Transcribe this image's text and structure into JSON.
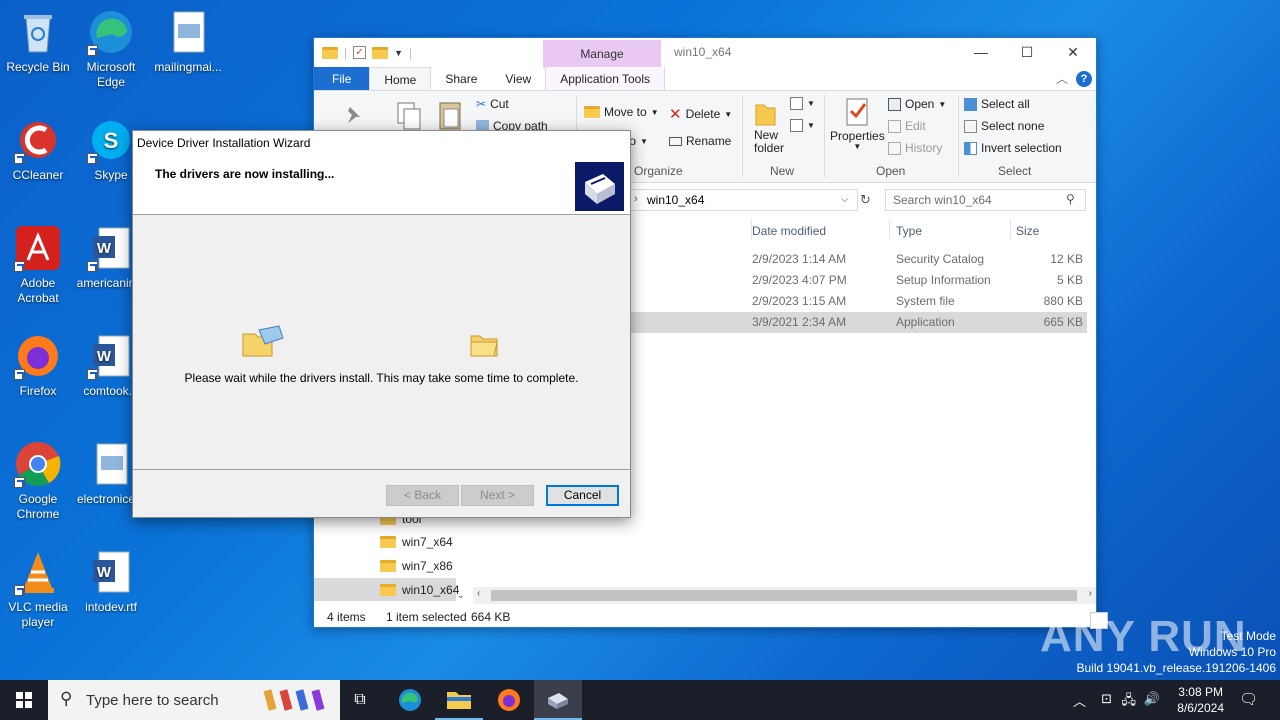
{
  "desktop": {
    "icons": [
      {
        "label": "Recycle Bin",
        "icon": "recycle-bin-icon"
      },
      {
        "label": "Microsoft Edge",
        "icon": "edge-icon"
      },
      {
        "label": "mailingmai...",
        "icon": "image-file-icon"
      },
      {
        "label": "CCleaner",
        "icon": "ccleaner-icon"
      },
      {
        "label": "Skype",
        "icon": "skype-icon"
      },
      {
        "label": "Adobe Acrobat",
        "icon": "acrobat-icon"
      },
      {
        "label": "americanin...",
        "icon": "word-doc-icon"
      },
      {
        "label": "Firefox",
        "icon": "firefox-icon"
      },
      {
        "label": "comtook...",
        "icon": "word-doc-icon"
      },
      {
        "label": "Google Chrome",
        "icon": "chrome-icon"
      },
      {
        "label": "electronice...",
        "icon": "image-file-icon"
      },
      {
        "label": "VLC media player",
        "icon": "vlc-icon"
      },
      {
        "label": "intodev.rtf",
        "icon": "word-doc-icon"
      }
    ]
  },
  "explorer": {
    "title": "win10_x64",
    "manage_tab": "Manage",
    "tabs": {
      "file": "File",
      "home": "Home",
      "share": "Share",
      "view": "View",
      "app_tools": "Application Tools"
    },
    "ribbon": {
      "cut": "Cut",
      "copy_path": "Copy path",
      "move_to": "Move to",
      "copy_to": "to",
      "delete": "Delete",
      "rename": "Rename",
      "new_folder": "New folder",
      "properties": "Properties",
      "open": "Open",
      "edit": "Edit",
      "history": "History",
      "select_all": "Select all",
      "select_none": "Select none",
      "invert_selection": "Invert selection",
      "groups": {
        "organize": "Organize",
        "new": "New",
        "open": "Open",
        "select": "Select"
      }
    },
    "address": "win10_x64",
    "search_placeholder": "Search win10_x64",
    "columns": {
      "date": "Date modified",
      "type": "Type",
      "size": "Size"
    },
    "files": [
      {
        "date": "2/9/2023 1:14 AM",
        "type": "Security Catalog",
        "size": "12 KB"
      },
      {
        "date": "2/9/2023 4:07 PM",
        "type": "Setup Information",
        "size": "5 KB"
      },
      {
        "date": "2/9/2023 1:15 AM",
        "type": "System file",
        "size": "880 KB"
      },
      {
        "date": "3/9/2021 2:34 AM",
        "type": "Application",
        "size": "665 KB"
      }
    ],
    "nav": [
      "tool",
      "win7_x64",
      "win7_x86",
      "win10_x64"
    ],
    "status": {
      "items": "4 items",
      "selected": "1 item selected",
      "size": "664 KB"
    }
  },
  "wizard": {
    "title": "Device Driver Installation Wizard",
    "heading": "The drivers are now installing...",
    "message": "Please wait while the drivers install. This may take some time to complete.",
    "back": "< Back",
    "next": "Next >",
    "cancel": "Cancel"
  },
  "taskbar": {
    "search_placeholder": "Type here to search",
    "time": "3:08 PM",
    "date": "8/6/2024"
  },
  "watermark": {
    "line1": "Test Mode",
    "line2": "Windows 10 Pro",
    "line3": "Build 19041.vb_release.191206-1406",
    "logo": "ANY RUN"
  }
}
